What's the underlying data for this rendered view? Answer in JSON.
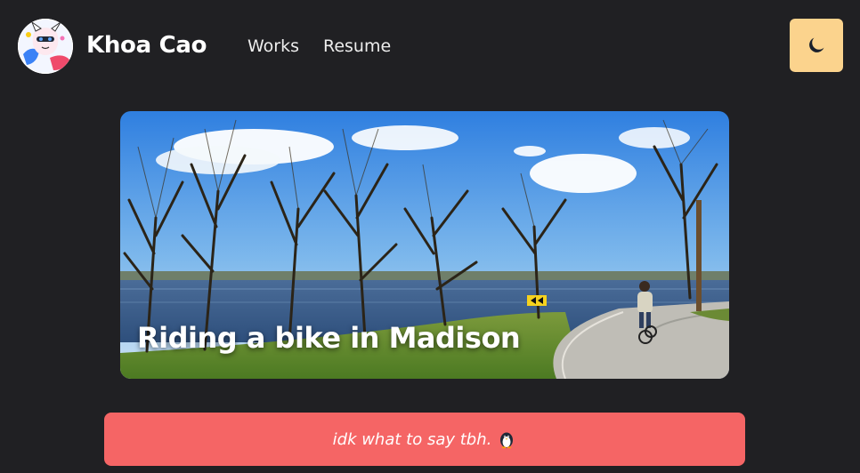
{
  "header": {
    "site_title": "Khoa Cao",
    "avatar_icon": "avatar-illustration",
    "nav": [
      {
        "label": "Works"
      },
      {
        "label": "Resume"
      }
    ],
    "theme_toggle_icon": "moon-icon"
  },
  "hero": {
    "caption": "Riding a bike in Madison"
  },
  "banner": {
    "text": "idk what to say tbh.",
    "icon": "penguin-icon"
  },
  "colors": {
    "background": "#202023",
    "theme_toggle": "#fbd38d",
    "banner": "#f56565",
    "text": "#ffffff"
  }
}
